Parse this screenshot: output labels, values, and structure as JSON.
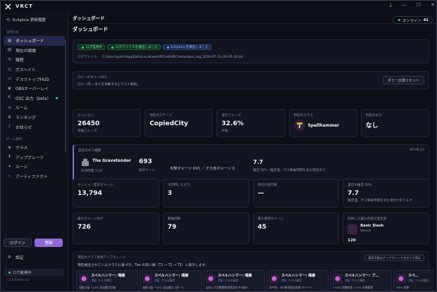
{
  "app": {
    "title": "VRCT",
    "window_controls": [
      "download-icon",
      "minimize-icon",
      "maximize-icon",
      "close-icon"
    ]
  },
  "sidebar": {
    "header_label": "Ecliptica 更新履歴",
    "section_realtime": "実時分析",
    "items": [
      {
        "label": "ダッシュボード",
        "icon": "grid-icon",
        "active": true
      },
      {
        "label": "現在の戦績",
        "icon": "chart-icon"
      },
      {
        "label": "履歴",
        "icon": "history-icon"
      },
      {
        "label": "ボスヘイト",
        "icon": "target-icon"
      },
      {
        "label": "デスクトップHUD",
        "icon": "monitor-icon"
      },
      {
        "label": "OBSオーバーレイ",
        "icon": "broadcast-icon"
      },
      {
        "label": "OSC 出力（beta）",
        "icon": "share-icon",
        "status_dot": true
      },
      {
        "label": "ルーム",
        "icon": "room-icon"
      },
      {
        "label": "ランキング",
        "icon": "trophy-icon"
      },
      {
        "label": "お知らせ",
        "icon": "bell-icon"
      }
    ],
    "section_data": "ゲーム資料",
    "items2": [
      {
        "label": "クラス",
        "icon": "class-icon"
      },
      {
        "label": "アップグレード",
        "icon": "upgrade-icon"
      },
      {
        "label": "ルーン",
        "icon": "rune-icon"
      },
      {
        "label": "アーティファクト",
        "icon": "artifact-icon"
      }
    ],
    "login_label": "ログイン",
    "signup_label": "登録",
    "settings_label": "設定",
    "status_label": "ログ監視中",
    "version": "v3.5.0-beta.12"
  },
  "header": {
    "title": "ダッシュボード",
    "online_label": "オンライン",
    "online_count": "41"
  },
  "dashboard": {
    "page_title": "ダッシュボード",
    "badges": [
      "ログ監視中",
      "ログファイルを検出しました",
      "Ecliptica を検出しました"
    ],
    "log_file_label": "ログファイル",
    "log_file_path": "C:\\Users\\yukin\\AppData\\LocalLow\\VRChat\\VRChat\\output_log_2026-07-23_00-05-34.txt",
    "lobby_title": "ロビーのダミーDPS",
    "lobby_desc": "ロビー内ー 木人を攻撃するとテスト開始。",
    "lobby_reset": "ダミー計測リセット",
    "stats": [
      {
        "label": "セッション",
        "value": "26450",
        "sub": "体験フェーズ"
      },
      {
        "label": "現在のステージ",
        "value": "CopiedCity",
        "sub": ""
      },
      {
        "label": "進行フェーズ",
        "value": "32.6%",
        "sub": "中盤"
      },
      {
        "label": "現在のクラス",
        "value": "Spellhammer",
        "sub": ""
      },
      {
        "label": "現在のボス",
        "value": "なし",
        "sub": ""
      }
    ],
    "boss": {
      "title": "直近のボス戦闘",
      "time": "00:28:12",
      "name": "The Gravetender",
      "duration": "討伐時間 1:30",
      "damage": "693",
      "damage_label": "総ダメージ",
      "attack_text": "攻撃ダメージ 693 ／ その他ダメージ 0",
      "dps": "7.7",
      "dps_label": "推定 DPS（推定値。ボス撃破時間を含む場合あり）"
    },
    "stats2": [
      {
        "label": "セッション累計ダメージ",
        "value": "13,794",
        "sub": ""
      },
      {
        "label": "今回倒したボス",
        "value": "3",
        "sub": ""
      },
      {
        "label": "現在の進行数",
        "value": "—",
        "sub": ""
      },
      {
        "label": "直近の推定 DPS",
        "value": "7.7",
        "sub": "推定値。ボス撃破時間を含む場合があります"
      }
    ],
    "stats3": [
      {
        "label": "最大ダメージ合計",
        "value": "726",
        "sub": ""
      },
      {
        "label": "撃破回数",
        "value": "79",
        "sub": ""
      },
      {
        "label": "最大被弾ダメージ",
        "value": "45",
        "sub": ""
      },
      {
        "label": "削除した最も危険な発生源",
        "value": "120",
        "skill": "Basic Slash",
        "skill_sub": "Steven"
      }
    ],
    "upgrades": {
      "title": "現在のクラス専用アップグレード",
      "desc": "現在検出されているクラスに基づき、Tier の高い順（T1 → T2 → T3）に表示します。",
      "show_all": "適用可能なアップグレードをすべて表示",
      "items": [
        {
          "name": "スペルハンマー: 鳴錬",
          "tier": "T1",
          "type": "クラス専用",
          "desc": "発動力量 +10% 追加魔力回復"
        },
        {
          "name": "スペルハンマー: 鳴錬",
          "tier": "T1",
          "type": "クラス専用",
          "desc": "発動力量 +10% 追加魔力上昇 +1"
        },
        {
          "name": "スペルハンマー: 鳴錬",
          "tier": "T1",
          "type": "クラス専用",
          "desc": "自身と大型戦闘時状態変化中の敵へ"
        },
        {
          "name": "スペルハンマー: 鳴錬",
          "tier": "T1",
          "type": "クラス専用",
          "desc": "命中時、Bを確率強化攻撃 ダメージ"
        },
        {
          "name": "スペルハンマー: プ…",
          "tier": "T1",
          "type": "クラス専用",
          "desc": "+10% 攻撃射程 +15% 攻撃範囲"
        },
        {
          "name": "スペ…",
          "tier": "T1",
          "type": "クラス専用",
          "desc": "+8% 攻撃"
        }
      ]
    }
  },
  "colors": {
    "accent": "#8e6ad8",
    "active_nav": "#23274a",
    "online": "#3ad37c",
    "panel": "#12151f"
  }
}
